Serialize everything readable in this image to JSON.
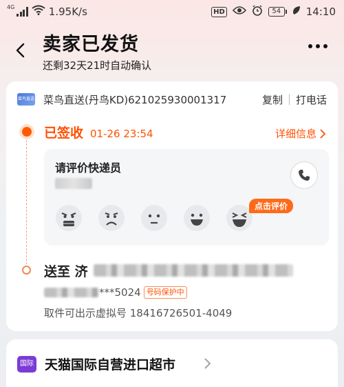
{
  "status_bar": {
    "network_tag": "4G",
    "speed": "1.95K/s",
    "hd_badge": "HD",
    "battery": "54",
    "time": "14:10"
  },
  "header": {
    "title": "卖家已发货",
    "subtitle": "还剩32天21时自动确认"
  },
  "carrier": {
    "logo_text": "菜鸟直送",
    "name": "菜鸟直送(丹鸟KD)621025930001317",
    "copy_label": "复制",
    "call_label": "打电话"
  },
  "tracking": {
    "status": "已签收",
    "time": "01-26 23:54",
    "detail_label": "详细信息"
  },
  "rating": {
    "title": "请评价快递员",
    "bubble": "点击评价",
    "faces": [
      "very-angry-face-icon",
      "sad-face-icon",
      "neutral-face-icon",
      "smile-face-icon",
      "laughing-face-icon"
    ]
  },
  "address": {
    "label": "送至 济",
    "phone_suffix": "***5024",
    "phone_badge": "号码保护中",
    "virtual_number": "取件可出示虚拟号 18416726501-4049"
  },
  "store": {
    "logo_text": "国际",
    "name": "天猫国际自营进口超市"
  },
  "colors": {
    "accent": "#ff5000",
    "store_purple": "#7b3bd6"
  }
}
